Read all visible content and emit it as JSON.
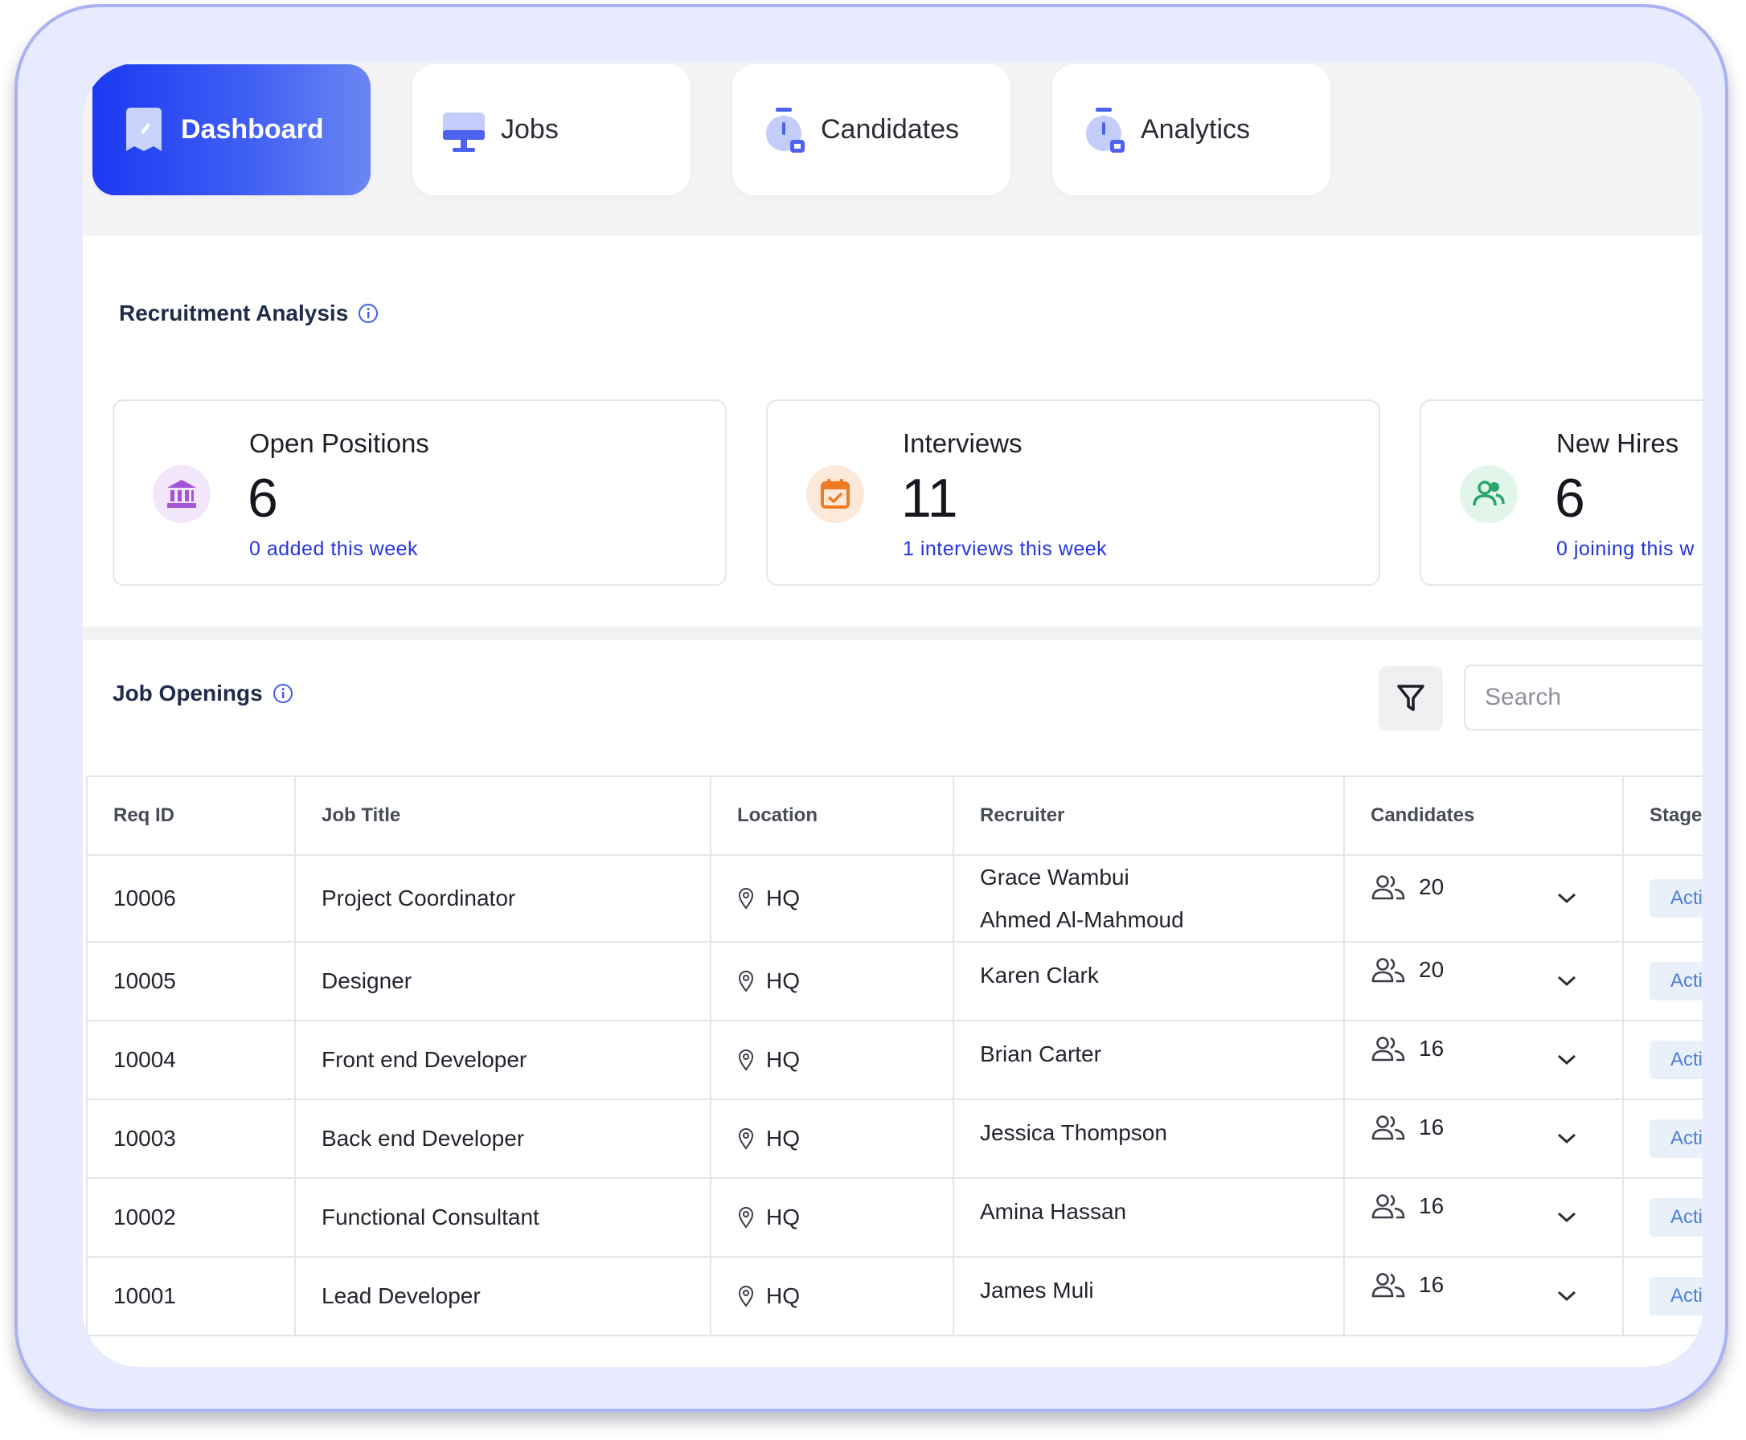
{
  "nav": {
    "tabs": [
      {
        "label": "Dashboard",
        "active": true
      },
      {
        "label": "Jobs"
      },
      {
        "label": "Candidates"
      },
      {
        "label": "Analytics"
      }
    ]
  },
  "analysis": {
    "title": "Recruitment Analysis",
    "cards": [
      {
        "title": "Open Positions",
        "value": "6",
        "sub": "0 added this week",
        "icon": "bank-icon",
        "icon_color": "#a455d6",
        "icon_bg": "#f3e6fb"
      },
      {
        "title": "Interviews",
        "value": "11",
        "sub": "1 interviews this week",
        "icon": "calendar-icon",
        "icon_color": "#ef7a22",
        "icon_bg": "#fde9da"
      },
      {
        "title": "New Hires",
        "value": "6",
        "sub": "0 joining this w",
        "icon": "users-icon",
        "icon_color": "#28a668",
        "icon_bg": "#e1f5ea"
      }
    ]
  },
  "openings": {
    "title": "Job Openings",
    "search_placeholder": "Search",
    "columns": [
      "Req ID",
      "Job Title",
      "Location",
      "Recruiter",
      "Candidates",
      "Stage"
    ],
    "rows": [
      {
        "req_id": "10006",
        "job_title": "Project Coordinator",
        "location": "HQ",
        "recruiters": [
          "Grace Wambui",
          "Ahmed Al-Mahmoud"
        ],
        "candidates": "20",
        "stage": "Acti"
      },
      {
        "req_id": "10005",
        "job_title": "Designer",
        "location": "HQ",
        "recruiters": [
          "Karen Clark"
        ],
        "candidates": "20",
        "stage": "Acti"
      },
      {
        "req_id": "10004",
        "job_title": "Front end Developer",
        "location": "HQ",
        "recruiters": [
          "Brian Carter"
        ],
        "candidates": "16",
        "stage": "Acti"
      },
      {
        "req_id": "10003",
        "job_title": "Back end Developer",
        "location": "HQ",
        "recruiters": [
          "Jessica Thompson"
        ],
        "candidates": "16",
        "stage": "Acti"
      },
      {
        "req_id": "10002",
        "job_title": "Functional Consultant",
        "location": "HQ",
        "recruiters": [
          "Amina Hassan"
        ],
        "candidates": "16",
        "stage": "Acti"
      },
      {
        "req_id": "10001",
        "job_title": "Lead Developer",
        "location": "HQ",
        "recruiters": [
          "James Muli"
        ],
        "candidates": "16",
        "stage": "Acti"
      }
    ]
  },
  "colors": {
    "accent": "#1b39f2",
    "link": "#2435e0"
  }
}
